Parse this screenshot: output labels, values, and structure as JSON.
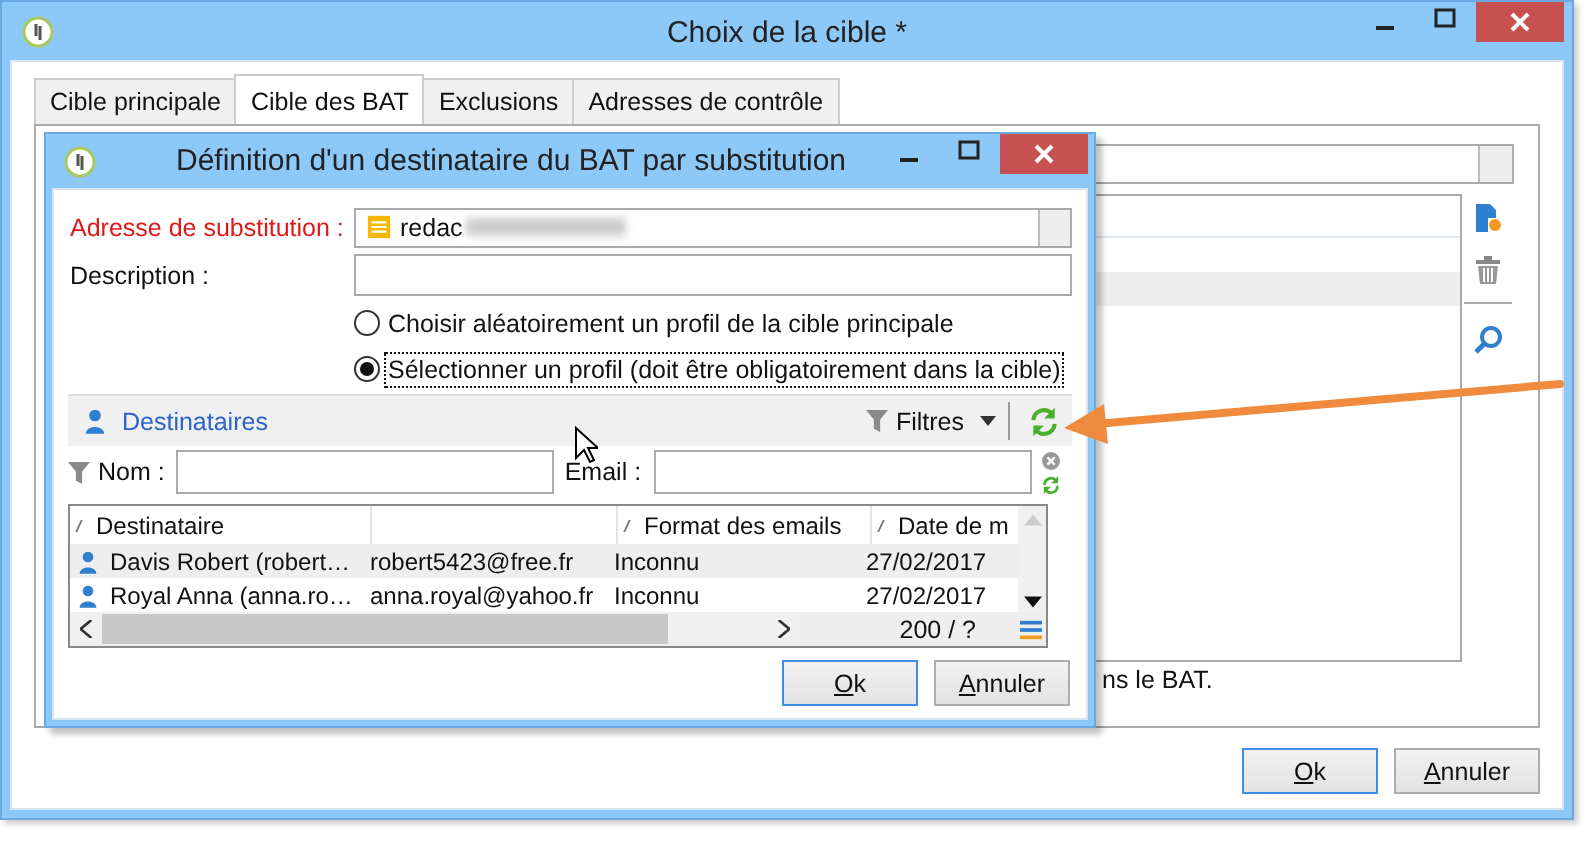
{
  "window": {
    "title": "Choix de la cible *"
  },
  "tabs": [
    {
      "label": "Cible principale",
      "selected": false
    },
    {
      "label": "Cible des BAT",
      "selected": true
    },
    {
      "label": "Exclusions",
      "selected": false
    },
    {
      "label": "Adresses de contrôle",
      "selected": false
    }
  ],
  "background_note": "ns le BAT.",
  "buttons": [
    {
      "label": "Ok",
      "default": true
    },
    {
      "label": "Annuler",
      "default": false
    }
  ],
  "dialog": {
    "title": "Définition d'un destinataire du BAT par substitution",
    "address": {
      "label": "Adresse de substitution :",
      "value": "redac"
    },
    "description": {
      "label": "Description :"
    },
    "options": [
      {
        "label": "Choisir aléatoirement un profil de la cible principale",
        "selected": false
      },
      {
        "label": "Sélectionner un profil (doit être obligatoirement dans la cible)",
        "selected": true
      }
    ],
    "toolbar": {
      "link": "Destinataires",
      "filter": "Filtres"
    },
    "filters": [
      {
        "label": "Nom :"
      },
      {
        "label": "Email :"
      }
    ],
    "table": {
      "columns": [
        {
          "kind": "text",
          "label": "Destinataire"
        },
        {
          "kind": "blank"
        },
        {
          "kind": "text",
          "label": "Format des emails"
        },
        {
          "kind": "text",
          "label": "Date de m"
        }
      ],
      "rows": [
        {
          "selected": true,
          "cells": [
            "Davis Robert (robert…",
            "robert5423@free.fr",
            "Inconnu",
            "27/02/2017"
          ]
        },
        {
          "selected": false,
          "cells": [
            "Royal Anna (anna.ro…",
            "anna.royal@yahoo.fr",
            "Inconnu",
            "27/02/2017"
          ]
        }
      ],
      "count": "200 / ?"
    },
    "buttons": [
      {
        "label": "Ok",
        "default": true
      },
      {
        "label": "Annuler",
        "default": false
      }
    ]
  }
}
